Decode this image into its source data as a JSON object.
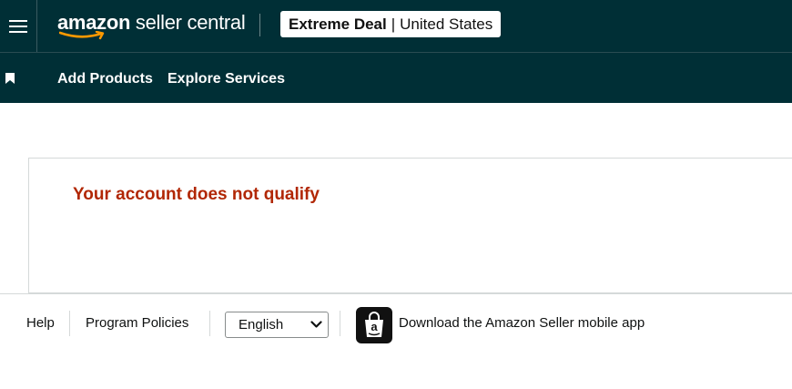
{
  "header": {
    "logo": {
      "brand": "amazon",
      "product": "seller central"
    },
    "store": {
      "name": "Extreme Deal",
      "separator": "|",
      "marketplace": "United States"
    }
  },
  "nav": {
    "items": [
      {
        "label": "Add Products"
      },
      {
        "label": "Explore Services"
      }
    ]
  },
  "main": {
    "message": "Your account does not qualify"
  },
  "footer": {
    "help": "Help",
    "policies": "Program Policies",
    "language": "English",
    "app_download": "Download the Amazon Seller mobile app"
  },
  "colors": {
    "header_bg": "#002f36",
    "error_text": "#b12704",
    "smile": "#ff9900"
  },
  "icons": [
    "menu-icon",
    "bookmark-icon",
    "chevron-down-icon",
    "amazon-app-icon"
  ]
}
